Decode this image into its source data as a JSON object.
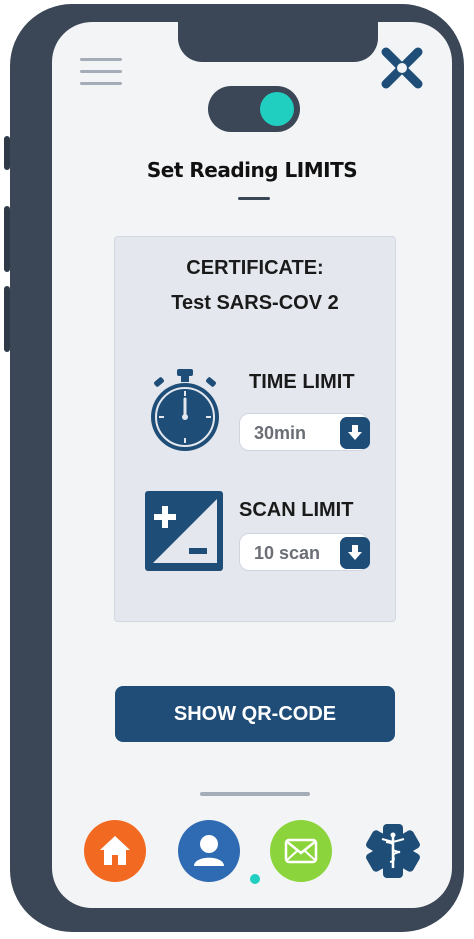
{
  "app": {
    "title": "Set Reading LIMITS"
  },
  "header": {
    "menu_icon": "hamburger-menu-icon",
    "close_icon": "close-x-icon",
    "toggle_state": "on",
    "accent_color": "#21cfc0"
  },
  "card": {
    "certificate_label": "CERTIFICATE:",
    "certificate_value": "Test SARS-COV 2",
    "time_limit": {
      "label": "TIME LIMIT",
      "selected": "30min",
      "icon": "stopwatch-icon"
    },
    "scan_limit": {
      "label": "SCAN LIMIT",
      "selected": "10 scan",
      "icon": "plus-minus-icon"
    }
  },
  "actions": {
    "show_qr_label": "SHOW QR-CODE",
    "primary_color": "#1f4d78"
  },
  "nav": {
    "items": [
      {
        "icon": "home-icon",
        "color": "#f26a22"
      },
      {
        "icon": "user-icon",
        "color": "#2f6bb2",
        "active": true
      },
      {
        "icon": "mail-icon",
        "color": "#8cd43c"
      },
      {
        "icon": "medical-caduceus-icon",
        "color": "#1f4d78"
      }
    ]
  }
}
